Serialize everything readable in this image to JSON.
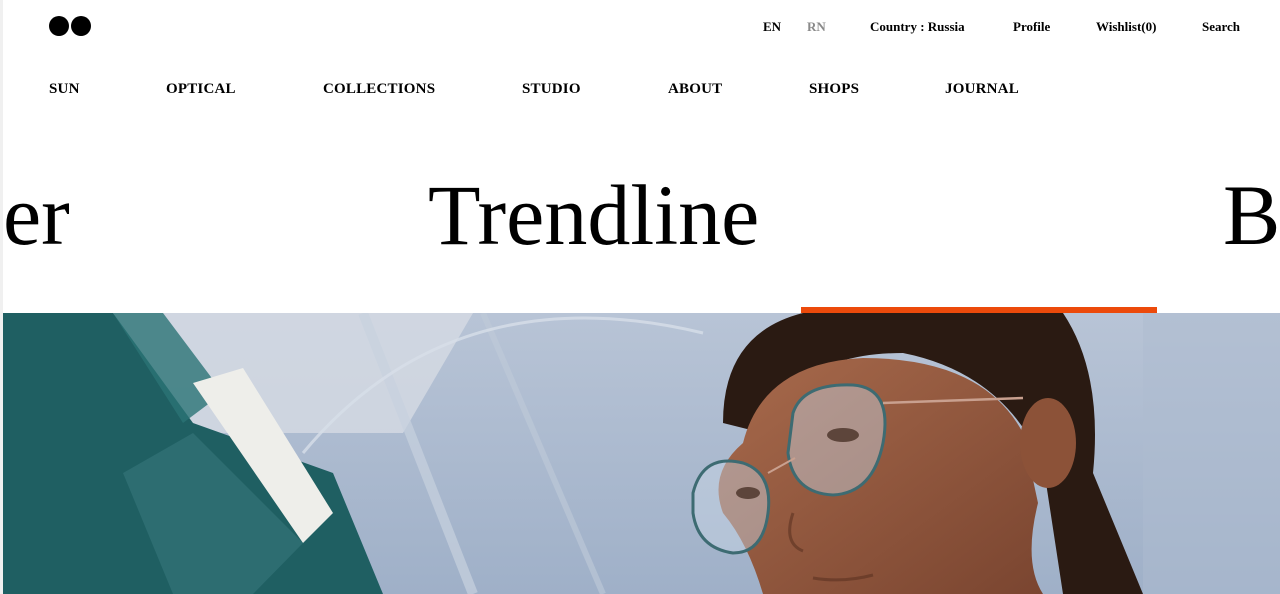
{
  "header": {
    "language": {
      "active": "EN",
      "inactive": "RN"
    },
    "country": "Country : Russia",
    "profile": "Profile",
    "wishlist": "Wishlist(0)",
    "search": "Search"
  },
  "nav": {
    "items": [
      "SUN",
      "OPTICAL",
      "COLLECTIONS",
      "STUDIO",
      "ABOUT",
      "SHOPS",
      "JOURNAL"
    ]
  },
  "carousel": {
    "prev_title_fragment": "er",
    "current_title": "Trendline",
    "next_title_fragment": "B",
    "progress": 0.5
  },
  "hero": {
    "image_subject": "woman wearing thin-frame glasses"
  },
  "colors": {
    "accent": "#ec4a0b",
    "text": "#000000",
    "muted": "#8a8a8a",
    "sky": "#a9b7cc",
    "teal": "#1f5f62"
  }
}
